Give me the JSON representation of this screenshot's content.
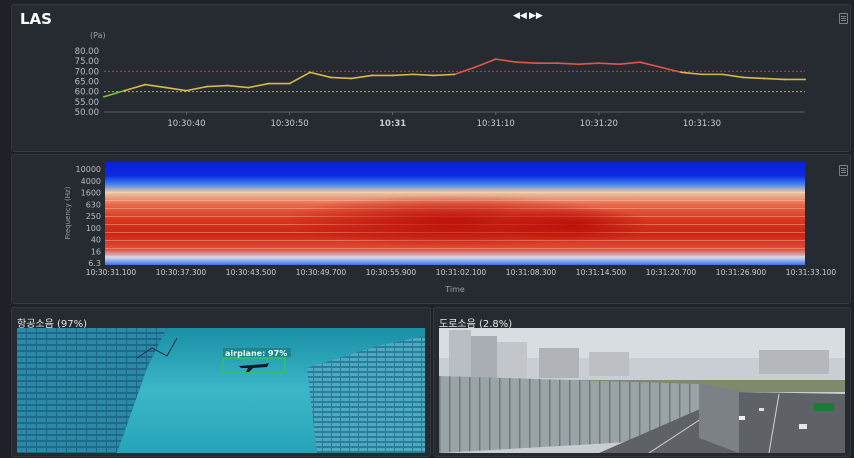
{
  "las_panel": {
    "title": "LAS",
    "prev_icon": "rewind-icon",
    "next_icon": "fast-forward-icon",
    "menu_icon": "document-menu-icon"
  },
  "spectrogram_panel": {
    "menu_icon": "document-menu-icon"
  },
  "camera_panels": [
    {
      "title": "항공소음 (97%)",
      "detection_label": "airplane: 97%"
    },
    {
      "title": "도로소음 (2.8%)"
    }
  ],
  "colors": {
    "panel_bg": "#262b32",
    "upper_threshold": "#d9453b",
    "lower_threshold": "#c8c83c",
    "detection_box": "#2ecc40",
    "low_energy": "#0a1fd6",
    "high_energy": "#cc1a10"
  },
  "chart_data": [
    {
      "type": "line",
      "title": "LAS",
      "ylabel": "(Pa)",
      "ylim": [
        50,
        80
      ],
      "y_ticks": [
        "80.00",
        "75.00",
        "70.00",
        "65.00",
        "60.00",
        "55.00",
        "50.00"
      ],
      "x_ticks": [
        "10:30:40",
        "10:30:50",
        "10:31",
        "10:31:10",
        "10:31:20",
        "10:31:30"
      ],
      "x_seconds": [
        0,
        2,
        4,
        6,
        8,
        10,
        12,
        14,
        16,
        18,
        20,
        22,
        24,
        26,
        28,
        30,
        32,
        34,
        36,
        38,
        40,
        42,
        44,
        46,
        48,
        50,
        52,
        54,
        56,
        58,
        60,
        62,
        64,
        66,
        68
      ],
      "values": [
        57.5,
        60.5,
        63.5,
        62,
        60.5,
        62.5,
        63,
        62,
        64,
        64,
        69.5,
        67,
        66.5,
        68,
        68,
        68.5,
        68,
        68.5,
        72,
        76,
        74.5,
        74,
        74,
        73.5,
        74,
        73.5,
        74.5,
        72,
        69.5,
        68.5,
        68.5,
        67,
        66.5,
        66,
        66
      ],
      "x_start": "10:30:32",
      "thresholds": [
        {
          "value": 70,
          "color": "#d9453b"
        },
        {
          "value": 60,
          "color": "#c8c83c"
        }
      ],
      "grid": false
    },
    {
      "type": "heatmap",
      "ylabel": "Frequency (Hz)",
      "xlabel": "Time",
      "y_ticks": [
        "10000",
        "4000",
        "1600",
        "630",
        "250",
        "100",
        "40",
        "16",
        "6.3"
      ],
      "x_ticks": [
        "10:30:31.100",
        "10:30:37.300",
        "10:30:43.500",
        "10:30:49.700",
        "10:30:55.900",
        "10:31:02.100",
        "10:31:08.300",
        "10:31:14.500",
        "10:31:20.700",
        "10:31:26.900",
        "10:31:33.100"
      ],
      "colormap": "jet"
    }
  ]
}
